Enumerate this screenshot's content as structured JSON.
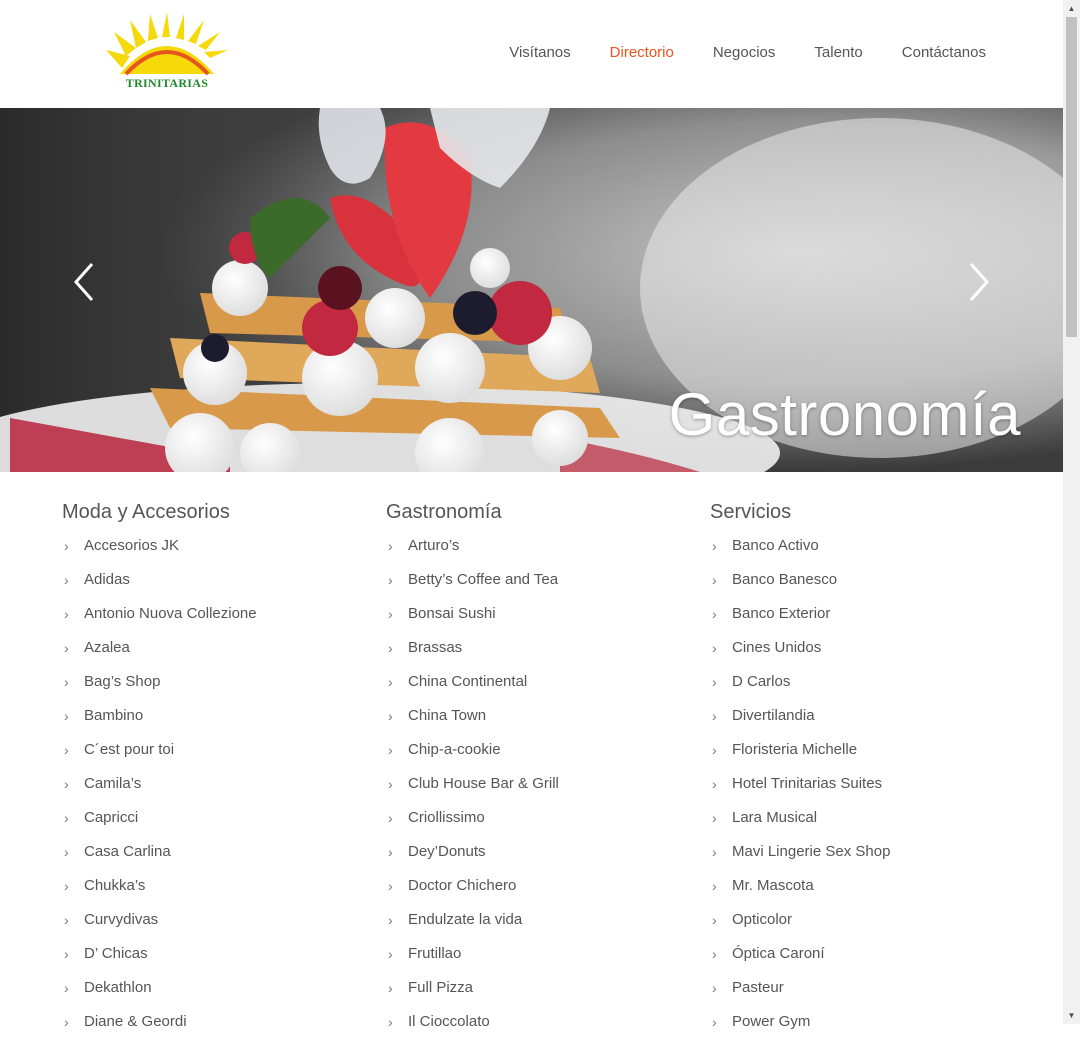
{
  "brand": {
    "logo_text": "TRINITARIAS"
  },
  "nav": {
    "items": [
      {
        "label": "Visítanos"
      },
      {
        "label": "Directorio"
      },
      {
        "label": "Negocios"
      },
      {
        "label": "Talento"
      },
      {
        "label": "Contáctanos"
      }
    ],
    "active_index": 1,
    "active_color": "#e8541e"
  },
  "hero": {
    "caption": "Gastronomía",
    "prev_icon": "chevron-left-icon",
    "next_icon": "chevron-right-icon"
  },
  "directory": {
    "columns": [
      {
        "title": "Moda y Accesorios",
        "items": [
          "Accesorios JK",
          "Adidas",
          "Antonio Nuova Collezione",
          "Azalea",
          "Bag’s Shop",
          "Bambino",
          "C´est pour toi",
          "Camila’s",
          "Capricci",
          "Casa Carlina",
          "Chukka’s",
          "Curvydivas",
          "D’ Chicas",
          "Dekathlon",
          "Diane & Geordi"
        ]
      },
      {
        "title": "Gastronomía",
        "items": [
          "Arturo’s",
          "Betty’s Coffee and Tea",
          "Bonsai Sushi",
          "Brassas",
          "China Continental",
          "China Town",
          "Chip-a-cookie",
          "Club House Bar & Grill",
          "Criollissimo",
          "Dey’Donuts",
          "Doctor Chichero",
          "Endulzate la vida",
          "Frutillao",
          "Full Pizza",
          "Il Cioccolato"
        ]
      },
      {
        "title": "Servicios",
        "items": [
          "Banco Activo",
          "Banco Banesco",
          "Banco Exterior",
          "Cines Unidos",
          "D Carlos",
          "Divertilandia",
          "Floristeria Michelle",
          "Hotel Trinitarias Suites",
          "Lara Musical",
          "Mavi Lingerie Sex Shop",
          "Mr. Mascota",
          "Opticolor",
          "Óptica Caroní",
          "Pasteur",
          "Power Gym"
        ]
      }
    ]
  },
  "colors": {
    "text": "#555555",
    "accent": "#e8541e",
    "logo_green": "#1f8a2a",
    "logo_sun": "#f5d90a",
    "logo_arc": "#e8541e"
  }
}
